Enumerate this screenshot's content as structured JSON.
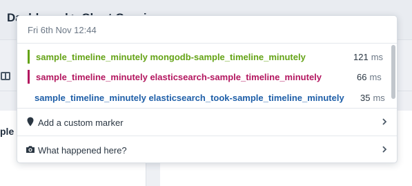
{
  "background": {
    "title": "Dashboard > Chart Cassius",
    "panel_title": "ple t"
  },
  "popover": {
    "time": "Fri 6th Nov 12:44",
    "series": [
      {
        "name": "sample_timeline_minutely mongodb-sample_timeline_minutely",
        "value": "121",
        "unit": "ms",
        "color": "#64a316"
      },
      {
        "name": "sample_timeline_minutely elasticsearch-sample_timeline_minutely",
        "value": "66",
        "unit": "ms",
        "color": "#b3165f"
      },
      {
        "name": "sample_timeline_minutely elasticsearch_took-sample_timeline_minutely",
        "value": "35",
        "unit": "ms",
        "color": "#1f5fa8"
      }
    ],
    "actions": [
      {
        "label": "Add a custom marker",
        "icon": "map-marker-icon"
      },
      {
        "label": "What happened here?",
        "icon": "camera-icon"
      }
    ]
  }
}
